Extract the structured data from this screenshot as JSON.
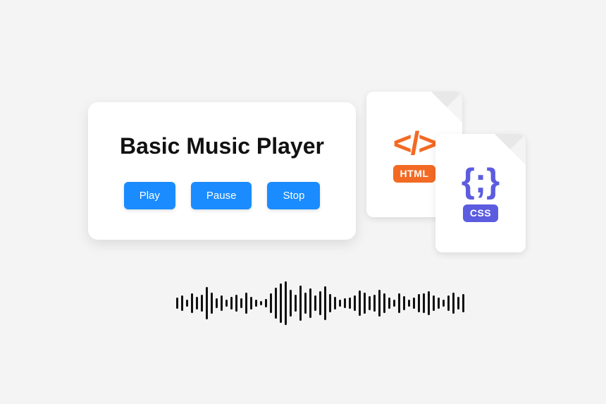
{
  "player": {
    "title": "Basic Music Player",
    "play": "Play",
    "pause": "Pause",
    "stop": "Stop"
  },
  "files": {
    "html_label": "HTML",
    "css_label": "CSS"
  },
  "waveform_heights": [
    16,
    22,
    10,
    28,
    18,
    24,
    46,
    30,
    14,
    22,
    10,
    18,
    24,
    14,
    30,
    18,
    10,
    6,
    12,
    28,
    44,
    56,
    62,
    38,
    24,
    50,
    30,
    42,
    22,
    34,
    48,
    26,
    18,
    10,
    14,
    16,
    22,
    36,
    30,
    20,
    24,
    38,
    28,
    16,
    10,
    28,
    20,
    10,
    16,
    26,
    28,
    34,
    22,
    16,
    10,
    22,
    30,
    18,
    26
  ]
}
